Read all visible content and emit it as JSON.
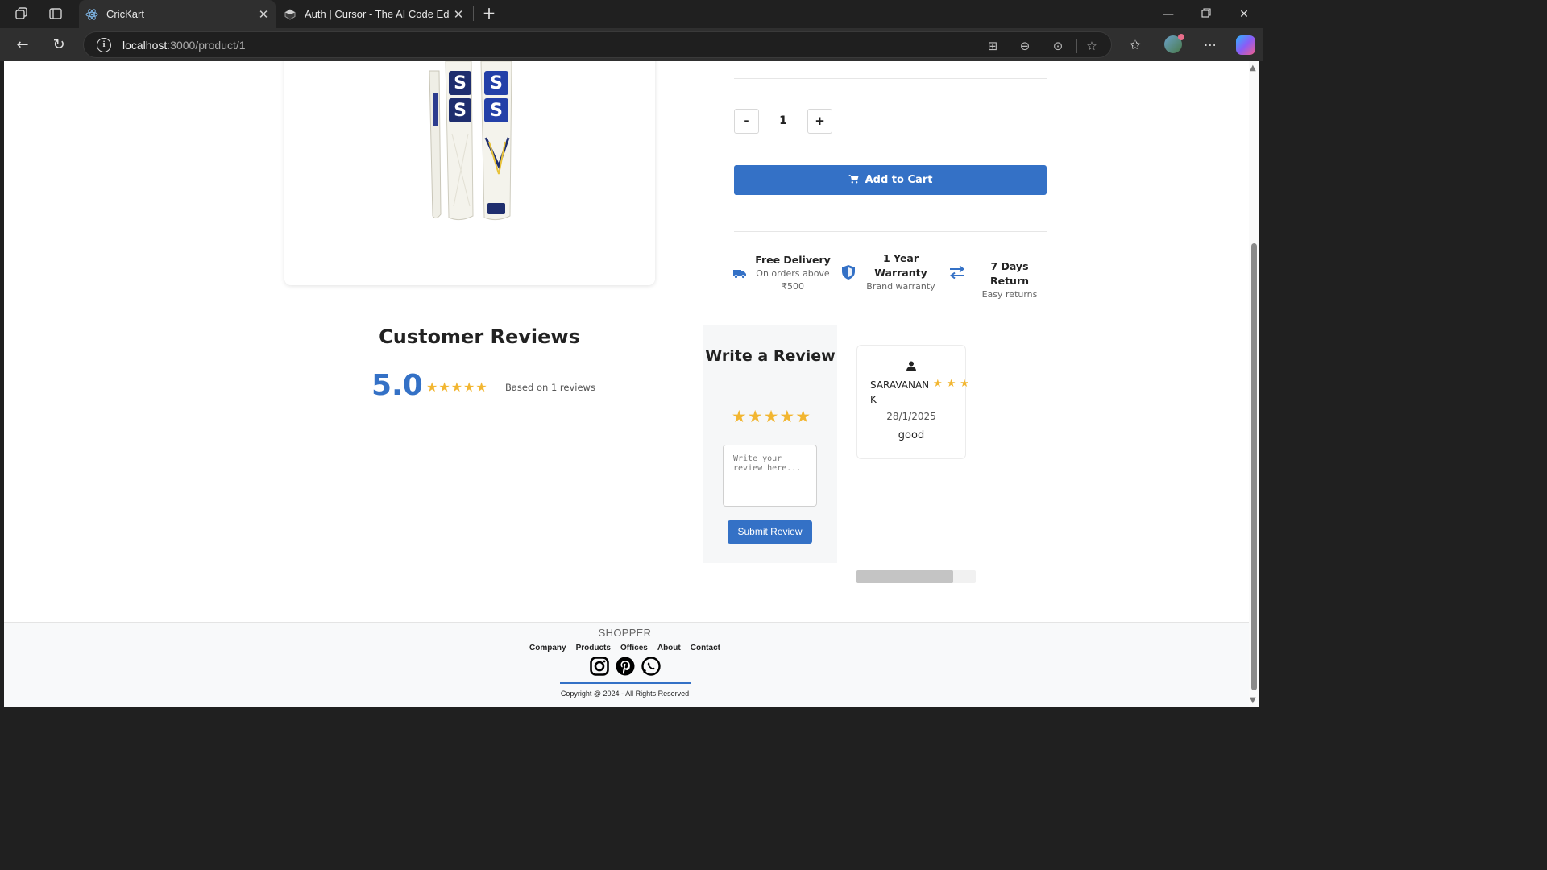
{
  "browser": {
    "tabs": [
      {
        "title": "CricKart",
        "favicon": "react-icon",
        "active": true
      },
      {
        "title": "Auth | Cursor - The AI Code Editor",
        "favicon": "cursor-icon",
        "active": false
      }
    ],
    "address": {
      "host": "localhost",
      "path": ":3000/product/1"
    }
  },
  "product": {
    "quantity": "1",
    "minus_label": "-",
    "plus_label": "+",
    "add_to_cart": "Add to Cart"
  },
  "features": [
    {
      "title": "Free Delivery",
      "subtitle_line1": "On orders above",
      "subtitle_line2": "₹500",
      "icon": "truck-icon"
    },
    {
      "title_line1": "1 Year",
      "title_line2": "Warranty",
      "subtitle": "Brand warranty",
      "icon": "shield-icon"
    },
    {
      "title": "7 Days Return",
      "subtitle": "Easy returns",
      "icon": "exchange-icon"
    }
  ],
  "reviews": {
    "heading": "Customer Reviews",
    "average": "5.0",
    "average_stars": "★★★★★",
    "based_on": "Based on 1 reviews",
    "write": {
      "title": "Write a Review",
      "stars": "★★★★★",
      "placeholder": "Write your review here...",
      "submit": "Submit Review"
    },
    "items": [
      {
        "name": "SARAVANAN K",
        "stars": "★★★",
        "date": "28/1/2025",
        "text": "good"
      }
    ]
  },
  "footer": {
    "brand": "SHOPPER",
    "links": [
      "Company",
      "Products",
      "Offices",
      "About",
      "Contact"
    ],
    "social": [
      "instagram-icon",
      "pinterest-icon",
      "whatsapp-icon"
    ],
    "copyright": "Copyright @ 2024 - All Rights Reserved"
  },
  "colors": {
    "accent": "#3471c6",
    "star": "#f2b631"
  }
}
